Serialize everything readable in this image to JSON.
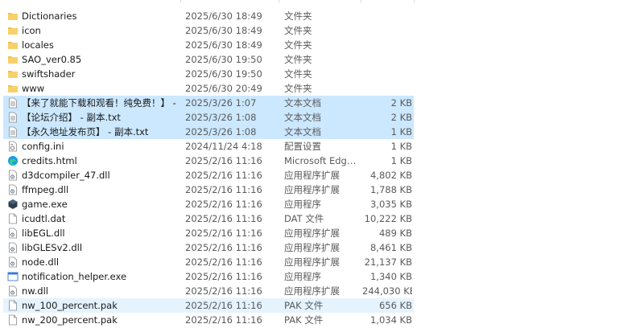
{
  "colors": {
    "folder": "#f5c244",
    "selection": "#cce8ff",
    "hover": "#e5f3ff"
  },
  "files": [
    {
      "name": "Dictionaries",
      "date": "2025/6/30 18:49",
      "type": "文件夹",
      "size": "",
      "icon": "folder-icon"
    },
    {
      "name": "icon",
      "date": "2025/6/30 18:49",
      "type": "文件夹",
      "size": "",
      "icon": "folder-icon"
    },
    {
      "name": "locales",
      "date": "2025/6/30 18:49",
      "type": "文件夹",
      "size": "",
      "icon": "folder-icon"
    },
    {
      "name": "SAO_ver0.85",
      "date": "2025/6/30 19:50",
      "type": "文件夹",
      "size": "",
      "icon": "folder-icon"
    },
    {
      "name": "swiftshader",
      "date": "2025/6/30 19:50",
      "type": "文件夹",
      "size": "",
      "icon": "folder-icon"
    },
    {
      "name": "www",
      "date": "2025/6/30 20:49",
      "type": "文件夹",
      "size": "",
      "icon": "folder-icon"
    },
    {
      "name": "【来了就能下载和观看！纯免费！】 - 副本.txt",
      "date": "2025/3/26 1:07",
      "type": "文本文档",
      "size": "2 KB",
      "icon": "text-file-icon"
    },
    {
      "name": "【论坛介绍】 - 副本.txt",
      "date": "2025/3/26 1:08",
      "type": "文本文档",
      "size": "2 KB",
      "icon": "text-file-icon"
    },
    {
      "name": "【永久地址发布页】 - 副本.txt",
      "date": "2025/3/26 1:08",
      "type": "文本文档",
      "size": "1 KB",
      "icon": "text-file-icon"
    },
    {
      "name": "config.ini",
      "date": "2024/11/24 4:18",
      "type": "配置设置",
      "size": "1 KB",
      "icon": "config-file-icon"
    },
    {
      "name": "credits.html",
      "date": "2025/2/16 11:16",
      "type": "Microsoft Edge ...",
      "size": "1 KB",
      "icon": "edge-icon"
    },
    {
      "name": "d3dcompiler_47.dll",
      "date": "2025/2/16 11:16",
      "type": "应用程序扩展",
      "size": "4,802 KB",
      "icon": "dll-file-icon"
    },
    {
      "name": "ffmpeg.dll",
      "date": "2025/2/16 11:16",
      "type": "应用程序扩展",
      "size": "1,788 KB",
      "icon": "dll-file-icon"
    },
    {
      "name": "game.exe",
      "date": "2025/2/16 11:16",
      "type": "应用程序",
      "size": "3,035 KB",
      "icon": "game-exe-icon"
    },
    {
      "name": "icudtl.dat",
      "date": "2025/2/16 11:16",
      "type": "DAT 文件",
      "size": "10,222 KB",
      "icon": "blank-file-icon"
    },
    {
      "name": "libEGL.dll",
      "date": "2025/2/16 11:16",
      "type": "应用程序扩展",
      "size": "489 KB",
      "icon": "dll-file-icon"
    },
    {
      "name": "libGLESv2.dll",
      "date": "2025/2/16 11:16",
      "type": "应用程序扩展",
      "size": "8,461 KB",
      "icon": "dll-file-icon"
    },
    {
      "name": "node.dll",
      "date": "2025/2/16 11:16",
      "type": "应用程序扩展",
      "size": "21,137 KB",
      "icon": "dll-file-icon"
    },
    {
      "name": "notification_helper.exe",
      "date": "2025/2/16 11:16",
      "type": "应用程序",
      "size": "1,340 KB",
      "icon": "exe-window-icon"
    },
    {
      "name": "nw.dll",
      "date": "2025/2/16 11:16",
      "type": "应用程序扩展",
      "size": "244,030 KB",
      "icon": "dll-file-icon"
    },
    {
      "name": "nw_100_percent.pak",
      "date": "2025/2/16 11:16",
      "type": "PAK 文件",
      "size": "656 KB",
      "icon": "blank-file-icon"
    },
    {
      "name": "nw_200_percent.pak",
      "date": "2025/2/16 11:16",
      "type": "PAK 文件",
      "size": "1,034 KB",
      "icon": "blank-file-icon"
    }
  ]
}
